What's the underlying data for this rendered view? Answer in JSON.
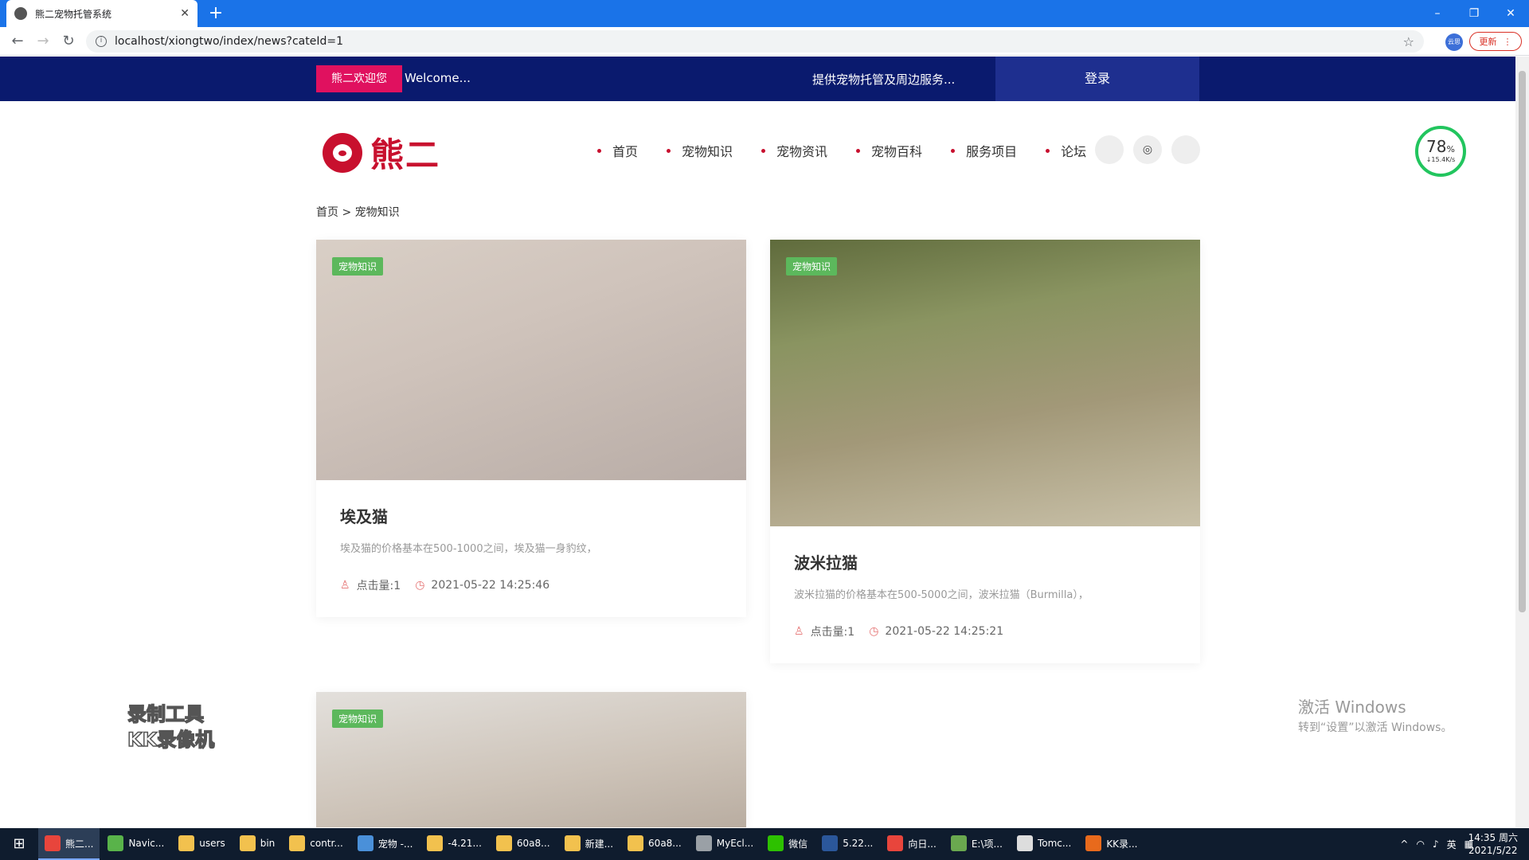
{
  "browser": {
    "tab_title": "熊二宠物托管系统",
    "url": "localhost/xiongtwo/index/news?cateId=1",
    "profile_label": "云思",
    "update_label": "更新",
    "new_tab": "+",
    "win_min": "–",
    "win_restore": "❐",
    "win_close": "✕",
    "back": "←",
    "forward": "→",
    "reload": "↻",
    "star": "☆",
    "close_tab": "✕",
    "more": "⋮"
  },
  "topbar": {
    "welcome_badge": "熊二欢迎您",
    "welcome_text": "Welcome...",
    "service_text": "提供宠物托管及周边服务...",
    "login": "登录"
  },
  "logo": {
    "text": "熊二"
  },
  "nav": {
    "items": [
      "首页",
      "宠物知识",
      "宠物资讯",
      "宠物百科",
      "服务项目",
      "论坛"
    ]
  },
  "breadcrumb": {
    "home": "首页",
    "sep": ">",
    "current": "宠物知识"
  },
  "cards": [
    {
      "tag": "宠物知识",
      "title": "埃及猫",
      "desc": "埃及猫的价格基本在500-1000之间，埃及猫一身豹纹，",
      "views": "点击量:1",
      "date": "2021-05-22 14:25:46"
    },
    {
      "tag": "宠物知识",
      "title": "波米拉猫",
      "desc": "波米拉猫的价格基本在500-5000之间，波米拉猫（Burmilla），",
      "views": "点击量:1",
      "date": "2021-05-22 14:25:21"
    },
    {
      "tag": "宠物知识"
    }
  ],
  "speed_widget": {
    "percent": "78",
    "unit": "%",
    "rate": "↓15.4K/s"
  },
  "watermark": {
    "line1": "录制工具",
    "line2": "KK录像机"
  },
  "activation": {
    "line1": "激活 Windows",
    "line2": "转到“设置”以激活 Windows。"
  },
  "taskbar": {
    "items": [
      {
        "label": "熊二...",
        "color": "#e8453c"
      },
      {
        "label": "Navic...",
        "color": "#59b34a"
      },
      {
        "label": "users",
        "color": "#f2c14e"
      },
      {
        "label": "bin",
        "color": "#f2c14e"
      },
      {
        "label": "contr...",
        "color": "#f2c14e"
      },
      {
        "label": "宠物 -...",
        "color": "#4a90d9"
      },
      {
        "label": "-4.21...",
        "color": "#f2c14e"
      },
      {
        "label": "60a8...",
        "color": "#f2c14e"
      },
      {
        "label": "新建...",
        "color": "#f2c14e"
      },
      {
        "label": "60a8...",
        "color": "#f2c14e"
      },
      {
        "label": "MyEcl...",
        "color": "#9aa0a6"
      },
      {
        "label": "微信",
        "color": "#2dc100"
      },
      {
        "label": "5.22...",
        "color": "#2b579a"
      },
      {
        "label": "向日...",
        "color": "#e8453c"
      },
      {
        "label": "E:\\项...",
        "color": "#6aa84f"
      },
      {
        "label": "Tomc...",
        "color": "#dddddd"
      },
      {
        "label": "KK录...",
        "color": "#e86a1c"
      }
    ],
    "ime": "英",
    "clock_time": "14:35 周六",
    "clock_date": "2021/5/22"
  }
}
